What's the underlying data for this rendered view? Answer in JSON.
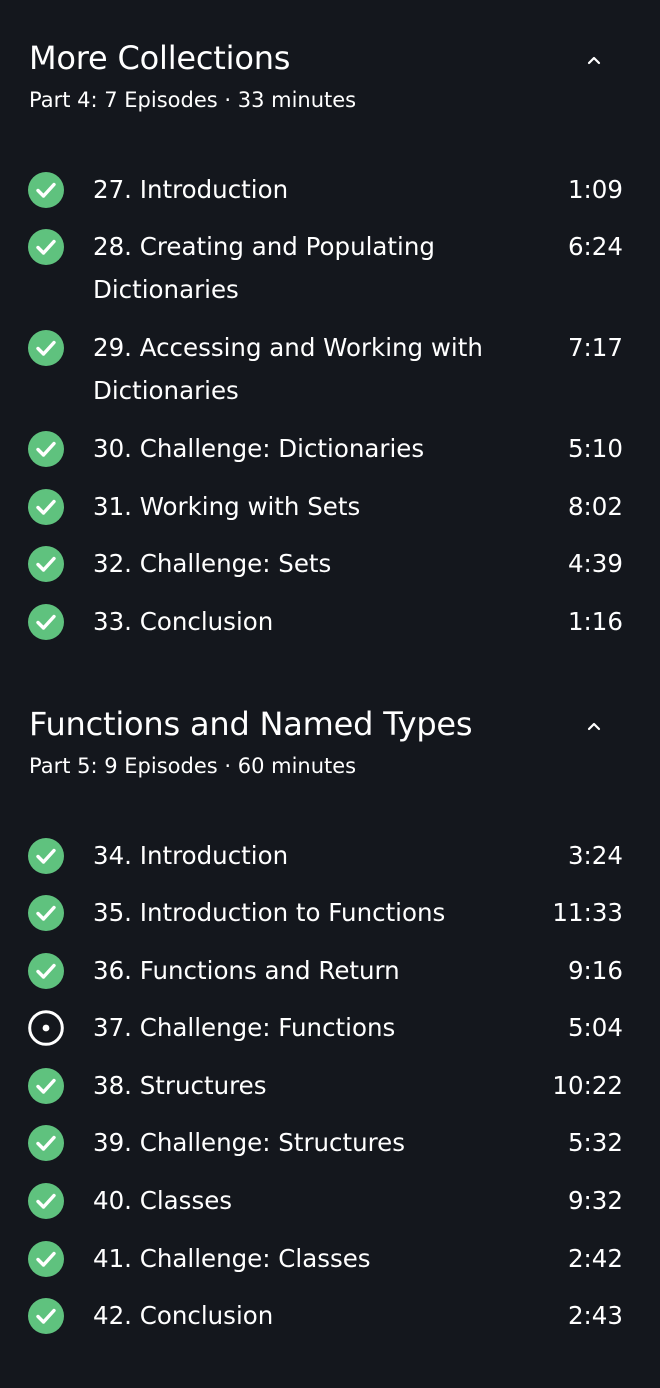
{
  "colors": {
    "background": "#14171d",
    "text": "#ffffff",
    "completed": "#5fc27e"
  },
  "sections": [
    {
      "title": "More Collections",
      "subtitle": "Part 4: 7 Episodes · 33 minutes",
      "collapse_icon": "chevron-up-icon",
      "episodes": [
        {
          "title": "27. Introduction",
          "duration": "1:09",
          "status": "completed"
        },
        {
          "title": "28. Creating and Populating Dictionaries",
          "duration": "6:24",
          "status": "completed"
        },
        {
          "title": "29. Accessing and Working with Dictionaries",
          "duration": "7:17",
          "status": "completed"
        },
        {
          "title": "30. Challenge: Dictionaries",
          "duration": "5:10",
          "status": "completed"
        },
        {
          "title": "31. Working with Sets",
          "duration": "8:02",
          "status": "completed"
        },
        {
          "title": "32. Challenge: Sets",
          "duration": "4:39",
          "status": "completed"
        },
        {
          "title": "33. Conclusion",
          "duration": "1:16",
          "status": "completed"
        }
      ]
    },
    {
      "title": "Functions and Named Types",
      "subtitle": "Part 5: 9 Episodes · 60 minutes",
      "collapse_icon": "chevron-up-icon",
      "episodes": [
        {
          "title": "34. Introduction",
          "duration": "3:24",
          "status": "completed"
        },
        {
          "title": "35. Introduction to Functions",
          "duration": "11:33",
          "status": "completed"
        },
        {
          "title": "36. Functions and Return",
          "duration": "9:16",
          "status": "completed"
        },
        {
          "title": "37. Challenge: Functions",
          "duration": "5:04",
          "status": "in-progress"
        },
        {
          "title": "38. Structures",
          "duration": "10:22",
          "status": "completed"
        },
        {
          "title": "39. Challenge: Structures",
          "duration": "5:32",
          "status": "completed"
        },
        {
          "title": "40. Classes",
          "duration": "9:32",
          "status": "completed"
        },
        {
          "title": "41. Challenge: Classes",
          "duration": "2:42",
          "status": "completed"
        },
        {
          "title": "42. Conclusion",
          "duration": "2:43",
          "status": "completed"
        }
      ]
    }
  ]
}
